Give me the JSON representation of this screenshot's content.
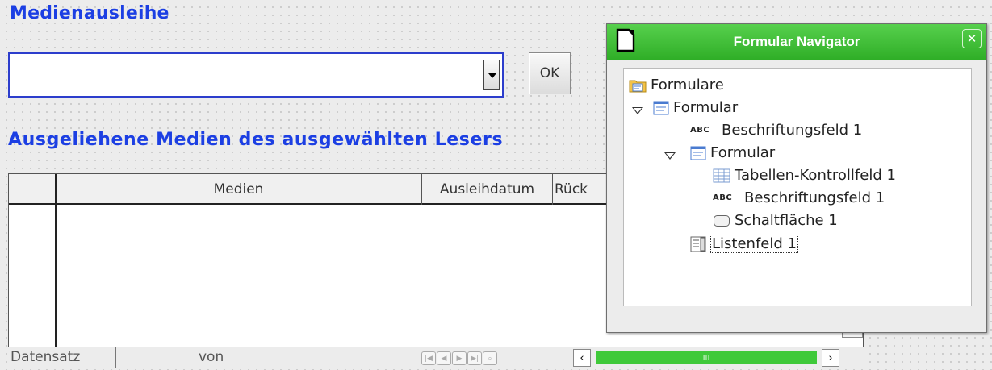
{
  "form": {
    "title": "Medienausleihe",
    "combo_value": "",
    "ok_label": "OK",
    "subtitle": "Ausgeliehene Medien des ausgewählten Lesers"
  },
  "grid": {
    "columns": [
      "Medien",
      "Ausleihdatum",
      "Rück"
    ]
  },
  "record_nav": {
    "record_label": "Datensatz",
    "record_value": "",
    "of_label": "von",
    "scroll_thumb": "III"
  },
  "navigator": {
    "title": "Formular Navigator",
    "close_glyph": "✕",
    "tree": {
      "root": "Formulare",
      "form1": "Formular",
      "label1": "Beschriftungsfeld 1",
      "form2": "Formular",
      "table_ctrl": "Tabellen-Kontrollfeld  1",
      "label2": "Beschriftungsfeld 1",
      "button": "Schaltfläche 1",
      "listbox": "Listenfeld 1",
      "abc_glyph": "ABC"
    }
  },
  "colors": {
    "heading_blue": "#1c3fe3",
    "titlebar_green": "#3fbf35",
    "scroll_green": "#3fc93a"
  },
  "icons": [
    "folder-form-icon",
    "form-icon",
    "label-icon",
    "table-control-icon",
    "button-icon",
    "listbox-icon",
    "close-icon",
    "document-icon",
    "dropdown-arrow-icon",
    "expand-triangle-icon"
  ]
}
